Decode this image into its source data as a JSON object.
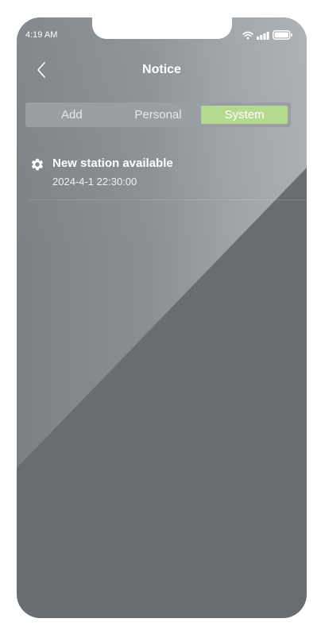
{
  "status_bar": {
    "time": "4:19 AM",
    "icons": [
      "wifi-icon",
      "signal-icon",
      "battery-icon"
    ]
  },
  "header": {
    "back_icon": "chevron-left-icon",
    "title": "Notice"
  },
  "tabs": [
    {
      "label": "Add",
      "active": false
    },
    {
      "label": "Personal",
      "active": false
    },
    {
      "label": "System",
      "active": true
    }
  ],
  "notices": [
    {
      "icon": "gear-icon",
      "title": "New station available",
      "time": "2024-4-1 22:30:00"
    }
  ],
  "colors": {
    "active_tab": "#b5d98e",
    "tab_bar": "#9a9fa4",
    "background": "#686d72",
    "text": "#ffffff"
  }
}
